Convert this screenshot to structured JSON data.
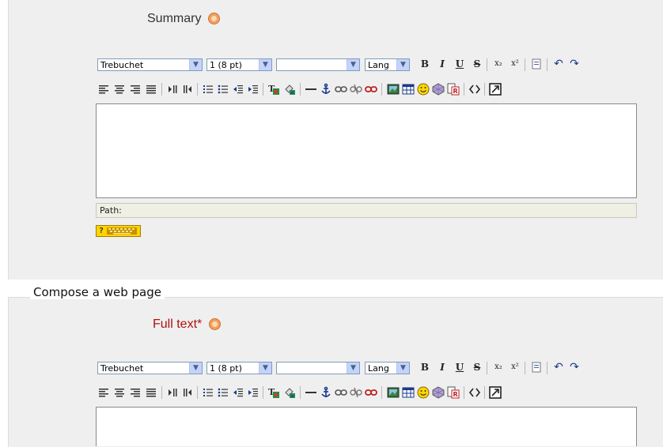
{
  "summary": {
    "label": "Summary",
    "editor": {
      "font_select": "Trebuchet",
      "size_select": "1 (8 pt)",
      "format_select": "",
      "lang_select": "Lang",
      "path_label": "Path:",
      "keyboard_help": "?"
    }
  },
  "compose": {
    "legend": "Compose a web page",
    "full_text_label": "Full text*",
    "editor": {
      "font_select": "Trebuchet",
      "size_select": "1 (8 pt)",
      "format_select": "",
      "lang_select": "Lang"
    }
  },
  "toolbar_icons": {
    "bold": "B",
    "italic": "I",
    "underline": "U",
    "strike": "S",
    "subscript": "x₂",
    "superscript": "x²",
    "undo": "↶",
    "redo": "↷"
  },
  "colors": {
    "fieldset_bg": "#efefef",
    "required_label": "#b01010",
    "select_arrow_bg": "#c3d3fd"
  }
}
